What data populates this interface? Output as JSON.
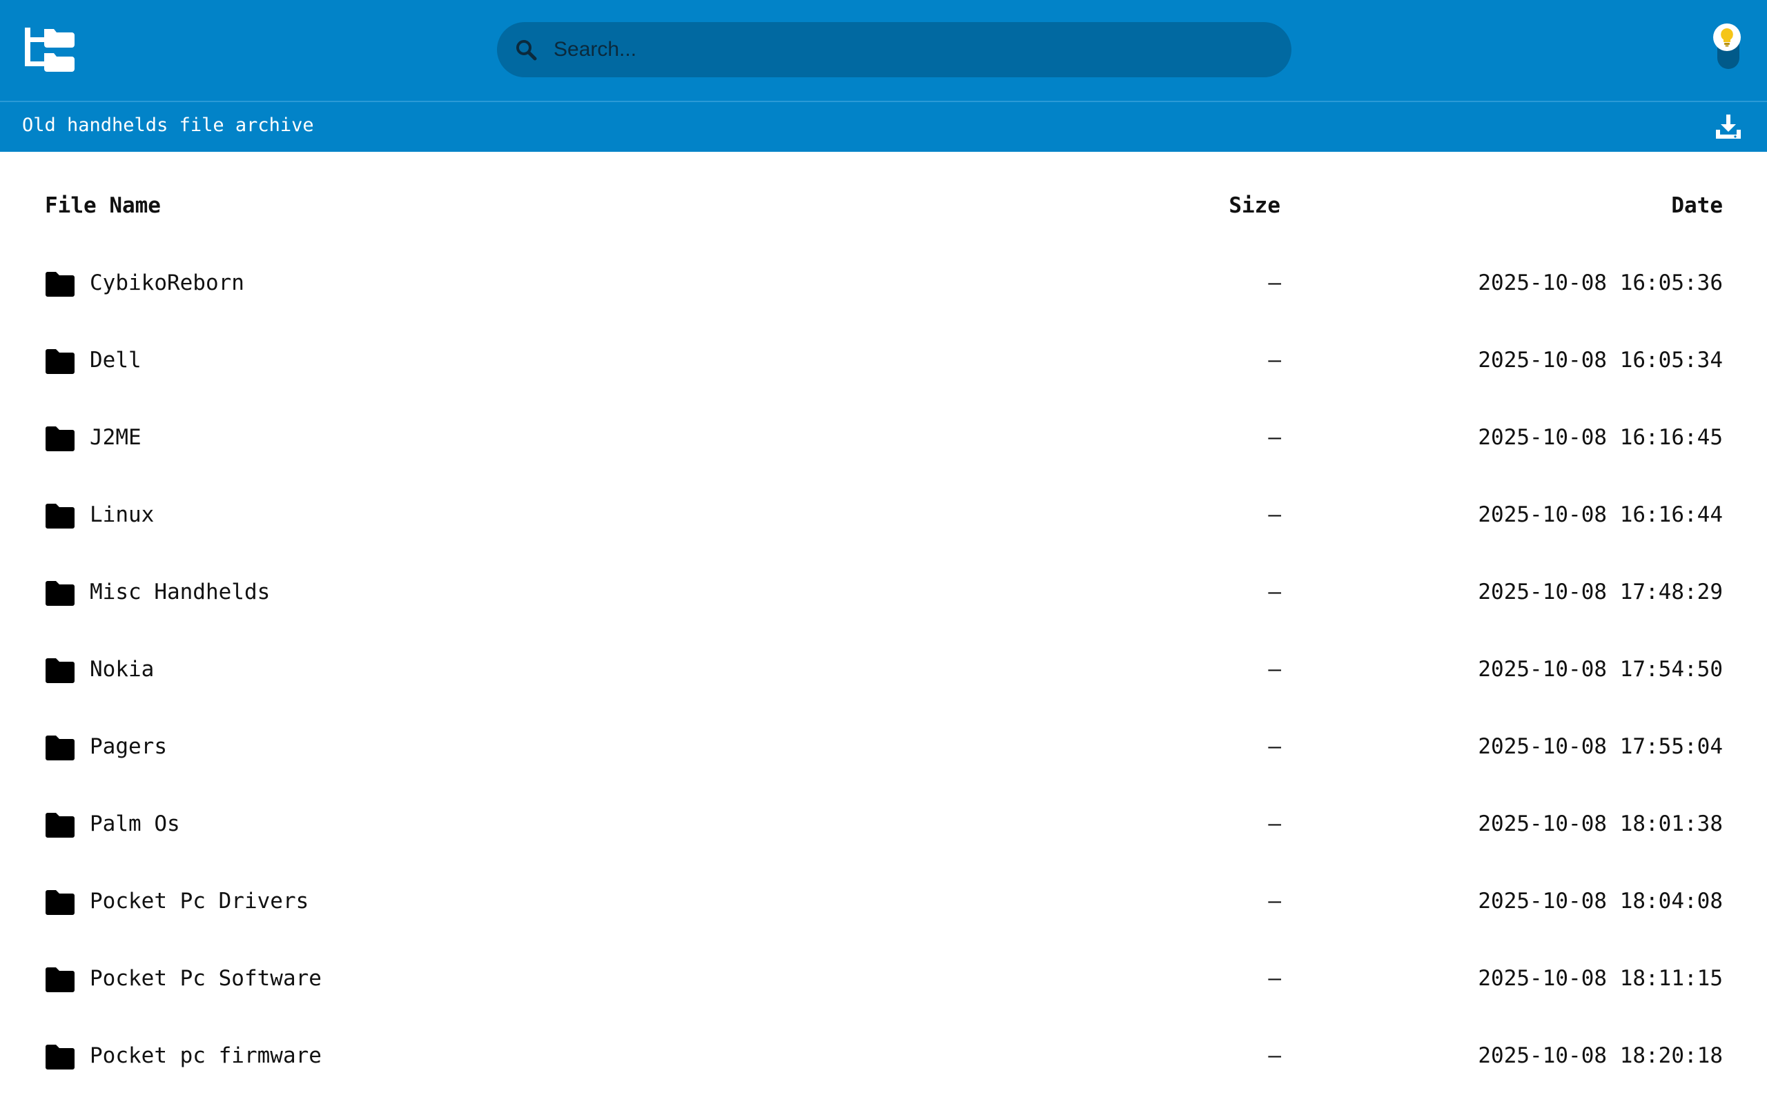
{
  "header": {
    "logo_icon": "folder-tree-icon",
    "search_placeholder": "Search...",
    "theme_icon": "lightbulb-icon"
  },
  "subheader": {
    "title": "Old handhelds file archive",
    "download_icon": "download-icon"
  },
  "table": {
    "columns": {
      "name": "File Name",
      "size": "Size",
      "date": "Date"
    },
    "rows": [
      {
        "name": "CybikoReborn",
        "size": "—",
        "date": "2025-10-08 16:05:36"
      },
      {
        "name": "Dell",
        "size": "—",
        "date": "2025-10-08 16:05:34"
      },
      {
        "name": "J2ME",
        "size": "—",
        "date": "2025-10-08 16:16:45"
      },
      {
        "name": "Linux",
        "size": "—",
        "date": "2025-10-08 16:16:44"
      },
      {
        "name": "Misc Handhelds",
        "size": "—",
        "date": "2025-10-08 17:48:29"
      },
      {
        "name": "Nokia",
        "size": "—",
        "date": "2025-10-08 17:54:50"
      },
      {
        "name": "Pagers",
        "size": "—",
        "date": "2025-10-08 17:55:04"
      },
      {
        "name": "Palm Os",
        "size": "—",
        "date": "2025-10-08 18:01:38"
      },
      {
        "name": "Pocket Pc Drivers",
        "size": "—",
        "date": "2025-10-08 18:04:08"
      },
      {
        "name": "Pocket Pc Software",
        "size": "—",
        "date": "2025-10-08 18:11:15"
      },
      {
        "name": "Pocket pc firmware",
        "size": "—",
        "date": "2025-10-08 18:20:18"
      }
    ]
  },
  "colors": {
    "header_bg": "#0283c8",
    "search_bg": "#0169a1",
    "bulb": "#f5c518"
  }
}
